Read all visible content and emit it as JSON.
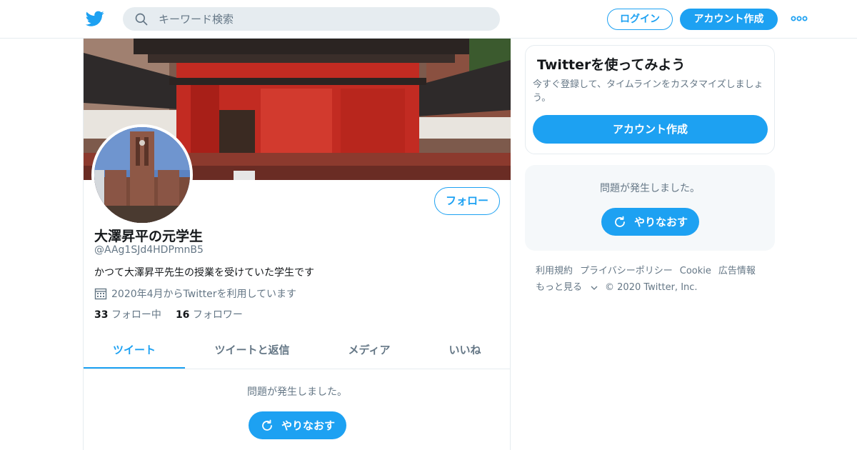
{
  "colors": {
    "accent": "#1da1f2",
    "muted": "#657786",
    "text": "#14171a",
    "border": "#e6ecf0"
  },
  "topbar": {
    "logo_icon": "twitter-bird-icon",
    "search_placeholder": "キーワード検索",
    "login_label": "ログイン",
    "signup_label": "アカウント作成",
    "more_icon": "more-dots-icon"
  },
  "profile": {
    "name": "大澤昇平の元学生",
    "handle": "@AAg1SJd4HDPmnB5",
    "bio": "かつて大澤昇平先生の授業を受けていた学生です",
    "joined": "2020年4月からTwitterを利用しています",
    "following_count": "33",
    "following_label": "フォロー中",
    "followers_count": "16",
    "followers_label": "フォロワー",
    "follow_label": "フォロー"
  },
  "tabs": [
    {
      "label": "ツイート",
      "active": true
    },
    {
      "label": "ツイートと返信",
      "active": false
    },
    {
      "label": "メディア",
      "active": false
    },
    {
      "label": "いいね",
      "active": false
    }
  ],
  "timeline": {
    "error_message": "問題が発生しました。",
    "retry_label": "やりなおす"
  },
  "sidebar": {
    "signup_card": {
      "title": "Twitterを使ってみよう",
      "description": "今すぐ登録して、タイムラインをカスタマイズしましょう。",
      "button_label": "アカウント作成"
    },
    "error_card": {
      "message": "問題が発生しました。",
      "retry_label": "やりなおす"
    },
    "footer": {
      "links": [
        "利用規約",
        "プライバシーポリシー",
        "Cookie",
        "広告情報"
      ],
      "more_label": "もっと見る",
      "copyright": "© 2020 Twitter, Inc."
    }
  }
}
